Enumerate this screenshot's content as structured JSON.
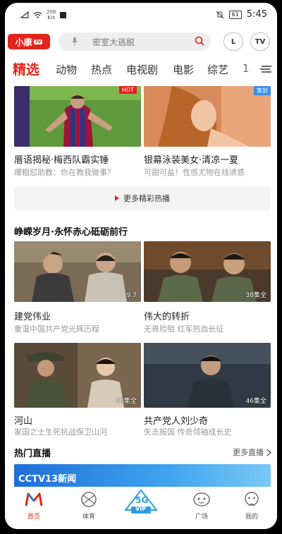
{
  "status_bar": {
    "speed_value": "208",
    "speed_unit": "K/s",
    "battery": "61",
    "time": "5:45"
  },
  "header": {
    "logo_text": "小康",
    "logo_badge": "TV",
    "search_placeholder": "密室大逃脱",
    "history_button_label": "L",
    "tv_button_label": "TV"
  },
  "tabs": [
    {
      "label": "精选",
      "active": true
    },
    {
      "label": "动物"
    },
    {
      "label": "热点"
    },
    {
      "label": "电视剧"
    },
    {
      "label": "电影"
    },
    {
      "label": "综艺"
    },
    {
      "label": "1"
    }
  ],
  "featured": [
    {
      "title": "厝语揭秘·梅西队霸实锤",
      "subtitle": "爆粗怼助教：你在教我做事？",
      "badge": "HOT"
    },
    {
      "title": "银幕泳装美女·清凉一夏",
      "subtitle": "可甜可盐！性感尤物在线诱惑",
      "badge": "策划"
    }
  ],
  "more_hot_label": "更多精彩热播",
  "section1": {
    "title": "峥嵘岁月·永怀赤心砥砺前行",
    "items": [
      {
        "title": "建党伟业",
        "subtitle": "重温中国共产党光辉历程",
        "badge": "9.7"
      },
      {
        "title": "伟大的转折",
        "subtitle": "无畏险阻 红军热血长征",
        "badge": "38集全"
      },
      {
        "title": "河山",
        "subtitle": "家国之士生死抗战保卫山河",
        "badge": "50集全"
      },
      {
        "title": "共产党人刘少奇",
        "subtitle": "矢志报国 传奇领袖成长史",
        "badge": "46集全"
      }
    ]
  },
  "live": {
    "title": "热门直播",
    "more_label": "更多直播",
    "banner_text": "CCTV13新闻"
  },
  "bottom_nav": [
    {
      "label": "首页",
      "active": true,
      "icon": "home-icon"
    },
    {
      "label": "体育",
      "icon": "sports-icon"
    },
    {
      "label": "VIP",
      "icon": "vip-5g-icon"
    },
    {
      "label": "广场",
      "icon": "plaza-icon"
    },
    {
      "label": "我的",
      "icon": "profile-icon"
    }
  ],
  "colors": {
    "accent": "#e1251b",
    "live_banner": "#1e6fd8"
  }
}
